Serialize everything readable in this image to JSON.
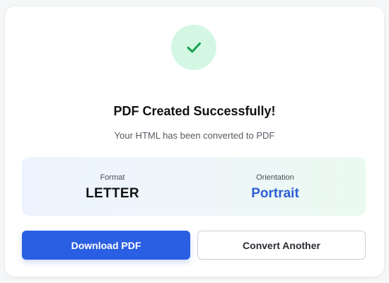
{
  "status": {
    "icon": "check-icon",
    "title": "PDF Created Successfully!",
    "message": "Your HTML has been converted to PDF"
  },
  "details": {
    "format_label": "Format",
    "format_value": "LETTER",
    "orientation_label": "Orientation",
    "orientation_value": "Portrait"
  },
  "actions": {
    "download_label": "Download PDF",
    "convert_another_label": "Convert Another"
  },
  "colors": {
    "accent": "#2b5fe3",
    "success": "#16a34a",
    "success_bg": "#d3f7e3",
    "orientation_text": "#2d5fd6"
  }
}
